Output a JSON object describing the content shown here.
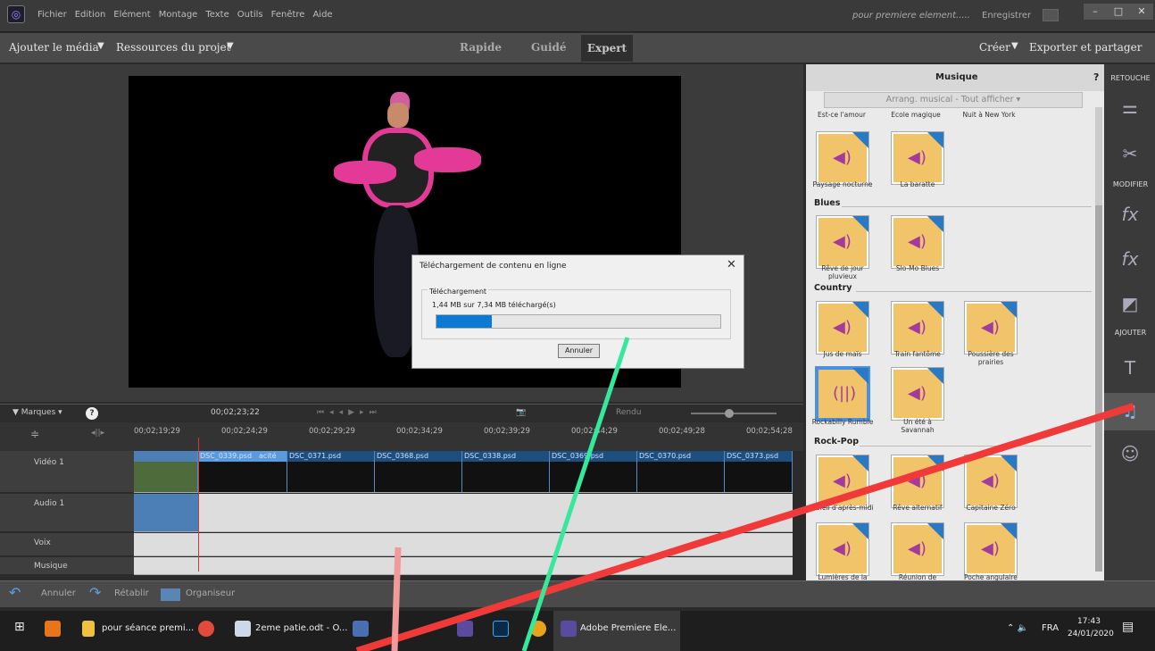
{
  "menubar": {
    "menus": [
      "Fichier",
      "Edition",
      "Elément",
      "Montage",
      "Texte",
      "Outils",
      "Fenêtre",
      "Aide"
    ],
    "project": "pour premiere element.....",
    "save": "Enregistrer"
  },
  "toolbar": {
    "add_media": "Ajouter le média",
    "project_resources": "Ressources du projet",
    "mode_quick": "Rapide",
    "mode_guided": "Guidé",
    "mode_expert": "Expert",
    "create": "Créer",
    "export": "Exporter et partager"
  },
  "dialog": {
    "title": "Téléchargement de contenu en ligne",
    "group_label": "Téléchargement",
    "progress_text": "1,44 MB sur 7,34 MB téléchargé(s)",
    "progress": 0.196,
    "cancel": "Annuler"
  },
  "timeline": {
    "markers": "Marques",
    "current_time": "00;02;23;22",
    "render": "Rendu",
    "ruler": [
      "00;02;19;29",
      "00;02;24;29",
      "00;02;29;29",
      "00;02;34;29",
      "00;02;39;29",
      "00;02;44;29",
      "00;02;49;28",
      "00;02;54;28"
    ],
    "tracks": [
      "Vidéo 1",
      "Audio 1",
      "Voix",
      "Musique"
    ],
    "clips": [
      "DSC_0339.psd",
      "acité",
      "DSC_0371.psd",
      "DSC_0368.psd",
      "DSC_0338.psd",
      "DSC_0369.psd",
      "DSC_0370.psd",
      "DSC_0373.psd"
    ]
  },
  "bottom": {
    "undo": "Annuler",
    "redo": "Rétablir",
    "organizer": "Organiseur"
  },
  "panel": {
    "title": "Musique",
    "help": "?",
    "dropdown": "Arrang. musical - Tout afficher",
    "top_labels": [
      "Est-ce l'amour",
      "Ecole magique",
      "Nuit à New York"
    ],
    "tiles_a": [
      "Paysage nocturne",
      "La baratte"
    ],
    "cat_blues": "Blues",
    "tiles_blues": [
      "Rêve de jour pluvieux",
      "Slo-Mo Blues"
    ],
    "cat_country": "Country",
    "tiles_country": [
      "Jus de maïs",
      "Train fantôme",
      "Poussière des prairies",
      "Rockabilly Rumble",
      "Un été à Savannah"
    ],
    "cat_rockpop": "Rock-Pop",
    "tiles_rockpop": [
      "Soleil d'après-midi",
      "Rêve alternatif",
      "Capitaine Zéro",
      "Lumières de la",
      "Réunion de",
      "Poche angulaire"
    ]
  },
  "iconcol": {
    "retouch": "RETOUCHE",
    "modify": "MODIFIER",
    "add": "AJOUTER"
  },
  "taskbar": {
    "items": [
      "pour séance premi...",
      "2eme patie.odt - O...",
      "Adobe Premiere Ele..."
    ],
    "lang": "FRA",
    "time": "17:43",
    "date": "24/01/2020"
  },
  "colors": {
    "annotation_red": "#f03a3a",
    "annotation_green": "#35e89a",
    "annotation_pink": "#f29a9a",
    "progress_blue": "#0a7ad4"
  }
}
